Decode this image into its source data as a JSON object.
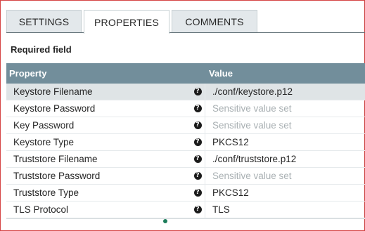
{
  "tabs": [
    {
      "label": "SETTINGS"
    },
    {
      "label": "PROPERTIES"
    },
    {
      "label": "COMMENTS"
    }
  ],
  "active_tab": "PROPERTIES",
  "required_label": "Required field",
  "table": {
    "headers": {
      "property": "Property",
      "value": "Value"
    },
    "rows": [
      {
        "name": "Keystore Filename",
        "value": "./conf/keystore.p12",
        "sensitive": false,
        "selected": true
      },
      {
        "name": "Keystore Password",
        "value": "Sensitive value set",
        "sensitive": true,
        "selected": false
      },
      {
        "name": "Key Password",
        "value": "Sensitive value set",
        "sensitive": true,
        "selected": false
      },
      {
        "name": "Keystore Type",
        "value": "PKCS12",
        "sensitive": false,
        "selected": false
      },
      {
        "name": "Truststore Filename",
        "value": "./conf/truststore.p12",
        "sensitive": false,
        "selected": false
      },
      {
        "name": "Truststore Password",
        "value": "Sensitive value set",
        "sensitive": true,
        "selected": false
      },
      {
        "name": "Truststore Type",
        "value": "PKCS12",
        "sensitive": false,
        "selected": false
      },
      {
        "name": "TLS Protocol",
        "value": "TLS",
        "sensitive": false,
        "selected": false
      }
    ]
  },
  "colors": {
    "header_bg": "#728e9b",
    "selected_row_bg": "#dfe4e6",
    "sensitive_text": "#a9b0b3",
    "accent_dot": "#1c7d5b"
  },
  "icons": {
    "help": "question-circle-icon"
  }
}
